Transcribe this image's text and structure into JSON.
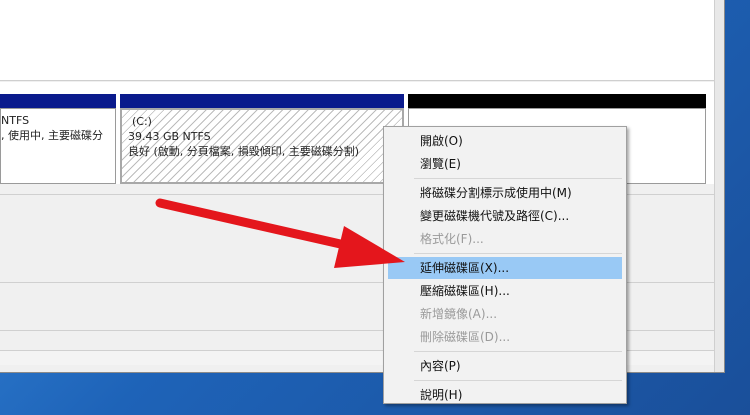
{
  "disk_map": {
    "partition1": {
      "line1": "NTFS",
      "line2": ", 使用中, 主要磁碟分"
    },
    "partition2": {
      "label": "(C:)",
      "size": "39.43 GB NTFS",
      "status": "良好 (啟動, 分頁檔案, 損毀傾印, 主要磁碟分割)"
    },
    "partition3": {
      "label": ""
    }
  },
  "context_menu": {
    "items": [
      {
        "label": "開啟(O)",
        "enabled": true
      },
      {
        "label": "瀏覽(E)",
        "enabled": true
      },
      {
        "label": "將磁碟分割標示成使用中(M)",
        "enabled": true
      },
      {
        "label": "變更磁碟機代號及路徑(C)...",
        "enabled": true
      },
      {
        "label": "格式化(F)...",
        "enabled": false
      },
      {
        "label": "延伸磁碟區(X)...",
        "enabled": true,
        "highlighted": true
      },
      {
        "label": "壓縮磁碟區(H)...",
        "enabled": true
      },
      {
        "label": "新增鏡像(A)...",
        "enabled": false
      },
      {
        "label": "刪除磁碟區(D)...",
        "enabled": false
      },
      {
        "label": "內容(P)",
        "enabled": true
      },
      {
        "label": "說明(H)",
        "enabled": true
      }
    ]
  },
  "colors": {
    "primary_partition_bar": "#0a1a8c",
    "unallocated_bar": "#000000",
    "menu_highlight": "#99c9f5",
    "arrow": "#e4161c"
  }
}
